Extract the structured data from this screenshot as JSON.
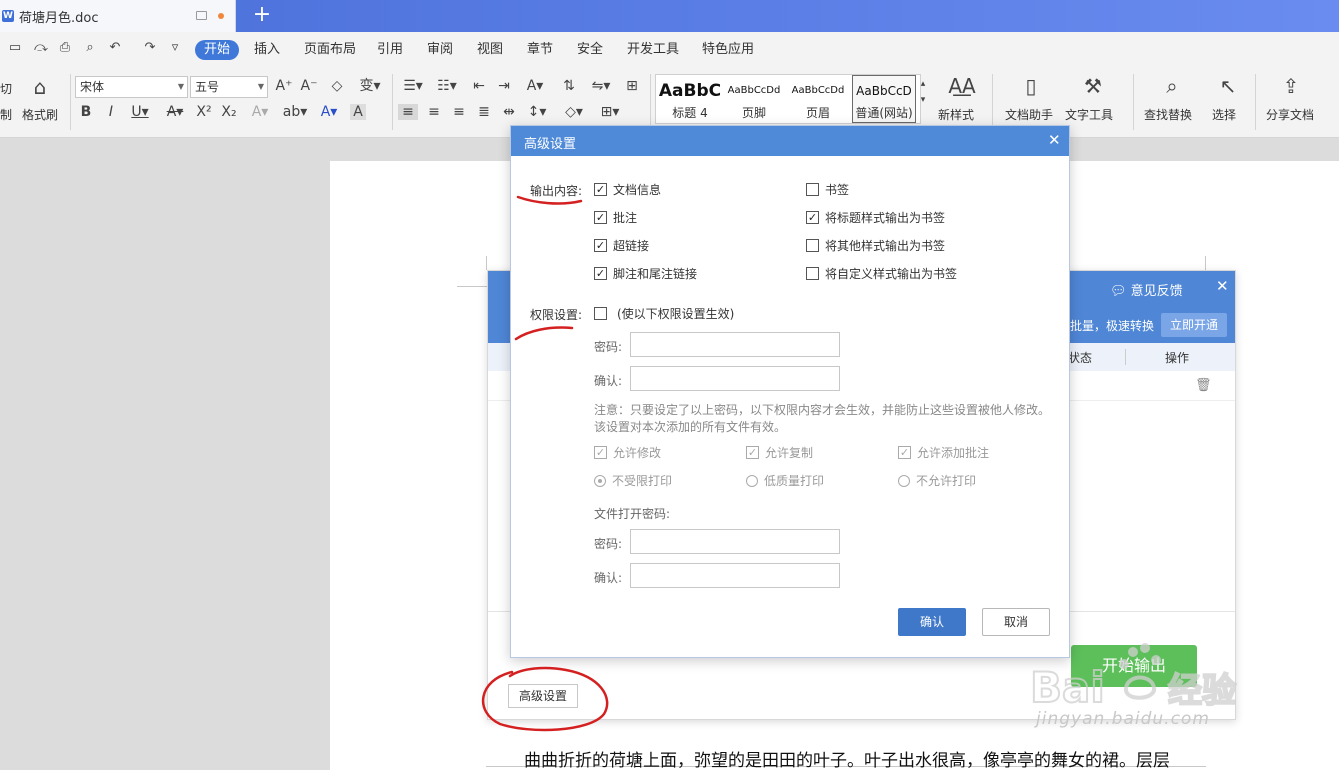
{
  "titlebar": {
    "doc_title": "荷塘月色.doc",
    "new_tab": "+"
  },
  "menu": {
    "items": [
      "开始",
      "插入",
      "页面布局",
      "引用",
      "审阅",
      "视图",
      "章节",
      "安全",
      "开发工具",
      "特色应用"
    ]
  },
  "ribbon": {
    "cut_label": "切",
    "copy_label": "制",
    "format_painter": "格式刷",
    "font_name": "宋体",
    "font_size": "五号",
    "styles": [
      {
        "sample": "AaBbC",
        "name": "标题 4"
      },
      {
        "sample": "AaBbCcDd",
        "name": "页脚"
      },
      {
        "sample": "AaBbCcDd",
        "name": "页眉"
      },
      {
        "sample": "AaBbCcD",
        "name": "普通(网站)"
      }
    ],
    "new_style": "新样式",
    "doc_helper": "文档助手",
    "text_tools": "文字工具",
    "find_replace": "查找替换",
    "select": "选择",
    "share": "分享文档"
  },
  "background_dialog": {
    "feedback": "意见反馈",
    "promo": "批量，极速转换",
    "open_now": "立即开通",
    "col_status": "状态",
    "col_action": "操作",
    "start_button": "开始输出",
    "advanced_button": "高级设置"
  },
  "dialog": {
    "title": "高级设置",
    "output_label": "输出内容:",
    "output_options": [
      {
        "label": "文档信息",
        "checked": true
      },
      {
        "label": "批注",
        "checked": true
      },
      {
        "label": "超链接",
        "checked": true
      },
      {
        "label": "脚注和尾注链接",
        "checked": true
      },
      {
        "label": "书签",
        "checked": false
      },
      {
        "label": "将标题样式输出为书签",
        "checked": true
      },
      {
        "label": "将其他样式输出为书签",
        "checked": false
      },
      {
        "label": "将自定义样式输出为书签",
        "checked": false
      }
    ],
    "permission_label": "权限设置:",
    "permission_toggle": "(使以下权限设置生效)",
    "password_label": "密码:",
    "confirm_label": "确认:",
    "note_line1": "注意：只要设定了以上密码，以下权限内容才会生效，并能防止这些设置被他人修改。",
    "note_line2": "该设置对本次添加的所有文件有效。",
    "permissions": [
      "允许修改",
      "允许复制",
      "允许添加批注"
    ],
    "print_options": [
      "不受限打印",
      "低质量打印",
      "不允许打印"
    ],
    "open_password_label": "文件打开密码:",
    "ok": "确认",
    "cancel": "取消"
  },
  "document": {
    "text": "曲曲折折的荷塘上面，弥望的是田田的叶子。叶子出水很高，像亭亭的舞女的裙。层层"
  },
  "watermark": {
    "text": "jingyan.baidu.com"
  }
}
